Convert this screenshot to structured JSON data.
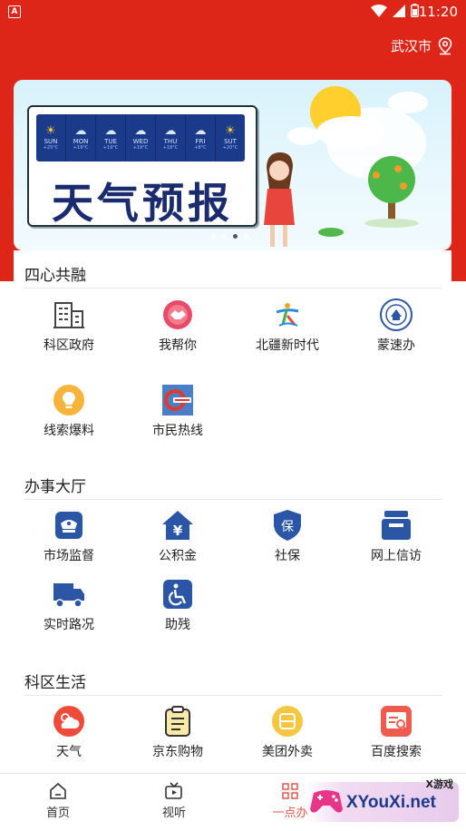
{
  "status_bar": {
    "time": "11:20",
    "left_icon_letter": "A"
  },
  "location": {
    "city": "武汉市"
  },
  "banner": {
    "title": "天气预报",
    "days": [
      {
        "label": "SUN",
        "temp": "+25°C"
      },
      {
        "label": "MON",
        "temp": "+19°C"
      },
      {
        "label": "TUE",
        "temp": "+19°C"
      },
      {
        "label": "WED",
        "temp": "+19°C"
      },
      {
        "label": "THU",
        "temp": "+18°C"
      },
      {
        "label": "FRI",
        "temp": "+8°C"
      },
      {
        "label": "SUT",
        "temp": "+20°C"
      }
    ],
    "page_count": 4,
    "active_page": 3
  },
  "sections": [
    {
      "title": "四心共融",
      "items": [
        {
          "label": "科区政府",
          "icon": "building-icon"
        },
        {
          "label": "我帮你",
          "icon": "handshake-icon"
        },
        {
          "label": "北疆新时代",
          "icon": "dancer-logo-icon"
        },
        {
          "label": "蒙速办",
          "icon": "emblem-icon"
        },
        {
          "label": "线索爆料",
          "icon": "lightbulb-icon"
        },
        {
          "label": "市民热线",
          "icon": "hotline-logo-icon"
        }
      ]
    },
    {
      "title": "办事大厅",
      "items": [
        {
          "label": "市场监督",
          "icon": "officer-cap-icon"
        },
        {
          "label": "公积金",
          "icon": "yuan-house-icon"
        },
        {
          "label": "社保",
          "icon": "shield-bao-icon"
        },
        {
          "label": "网上信访",
          "icon": "mailbox-icon"
        },
        {
          "label": "实时路况",
          "icon": "truck-icon"
        },
        {
          "label": "助残",
          "icon": "wheelchair-icon"
        }
      ]
    },
    {
      "title": "科区生活",
      "items": [
        {
          "label": "天气",
          "icon": "weather-icon"
        },
        {
          "label": "京东购物",
          "icon": "shopping-list-icon"
        },
        {
          "label": "美团外卖",
          "icon": "delivery-box-icon"
        },
        {
          "label": "百度搜索",
          "icon": "search-card-icon"
        }
      ]
    }
  ],
  "tabs": [
    {
      "label": "首页",
      "icon": "home-icon"
    },
    {
      "label": "视听",
      "icon": "video-icon"
    },
    {
      "label": "一点办",
      "icon": "grid-icon"
    }
  ],
  "watermark": {
    "top": "X游戏",
    "main": "XYouXi.net"
  },
  "colors": {
    "header_red": "#dd2617",
    "blue_icon": "#2b55a5",
    "active_tab": "#e05a4f"
  }
}
